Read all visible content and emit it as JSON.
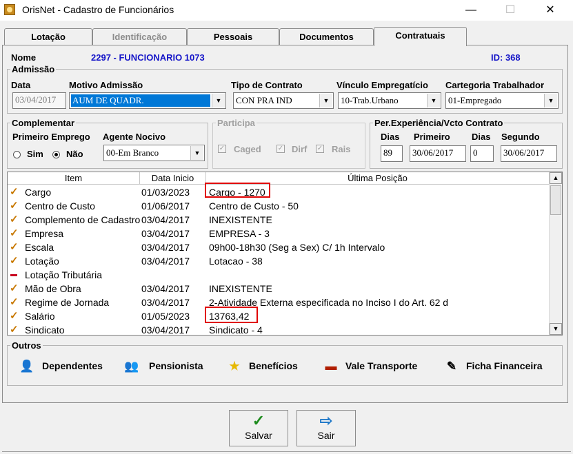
{
  "window": {
    "title": "OrisNet - Cadastro de Funcionários",
    "minimize": "—",
    "maximize": "☐",
    "close": "✕"
  },
  "tabs": [
    "Lotação",
    "Identificação",
    "Pessoais",
    "Documentos",
    "Contratuais"
  ],
  "header": {
    "nome_label": "Nome",
    "nome_value": "2297 - FUNCIONARIO 1073",
    "id_label": "ID: 368"
  },
  "admissao": {
    "legend": "Admissão",
    "data_label": "Data",
    "data_value": "03/04/2017",
    "motivo_label": "Motivo Admissão",
    "motivo_value": "AUM DE QUADR.",
    "tipo_label": "Tipo de Contrato",
    "tipo_value": "CON PRA IND",
    "vinculo_label": "Vínculo Empregatício",
    "vinculo_value": "10-Trab.Urbano",
    "categoria_label": "Cartegoria Trabalhador",
    "categoria_value": "01-Empregado"
  },
  "complementar": {
    "legend": "Complementar",
    "primeiro_emprego_label": "Primeiro Emprego",
    "sim_label": "Sim",
    "nao_label": "Não",
    "agente_label": "Agente Nocivo",
    "agente_value": "00-Em Branco"
  },
  "participa": {
    "legend": "Participa",
    "caged": "Caged",
    "dirf": "Dirf",
    "rais": "Rais"
  },
  "experiencia": {
    "legend": "Per.Experiência/Vcto Contrato",
    "dias_label": "Dias",
    "primeiro_label": "Primeiro",
    "dias2_label": "Dias",
    "segundo_label": "Segundo",
    "dias_value": "89",
    "primeiro_value": "30/06/2017",
    "dias2_value": "0",
    "segundo_value": "30/06/2017"
  },
  "grid": {
    "headers": [
      "Item",
      "Data Inicio",
      "Última Posição"
    ],
    "rows": [
      {
        "item": "Cargo",
        "data": "01/03/2023",
        "pos": "Cargo - 1270",
        "icon": "check"
      },
      {
        "item": "Centro de Custo",
        "data": "01/06/2017",
        "pos": "Centro de Custo - 50",
        "icon": "check"
      },
      {
        "item": "Complemento de Cadastro",
        "data": "03/04/2017",
        "pos": "INEXISTENTE",
        "icon": "check"
      },
      {
        "item": "Empresa",
        "data": "03/04/2017",
        "pos": "EMPRESA - 3",
        "icon": "check"
      },
      {
        "item": "Escala",
        "data": "03/04/2017",
        "pos": "09h00-18h30 (Seg a Sex) C/ 1h Intervalo",
        "icon": "check"
      },
      {
        "item": "Lotação",
        "data": "03/04/2017",
        "pos": "Lotacao - 38",
        "icon": "check"
      },
      {
        "item": "Lotação Tributária",
        "data": "",
        "pos": "",
        "icon": "dash"
      },
      {
        "item": "Mão de Obra",
        "data": "03/04/2017",
        "pos": "INEXISTENTE",
        "icon": "check"
      },
      {
        "item": "Regime de Jornada",
        "data": "03/04/2017",
        "pos": "2-Atividade Externa especificada no Inciso I do Art. 62 d",
        "icon": "check"
      },
      {
        "item": "Salário",
        "data": "01/05/2023",
        "pos": "13763,42",
        "icon": "check"
      },
      {
        "item": "Sindicato",
        "data": "03/04/2017",
        "pos": "Sindicato - 4",
        "icon": "check"
      }
    ]
  },
  "outros": {
    "legend": "Outros",
    "dependentes": "Dependentes",
    "pensionista": "Pensionista",
    "beneficios": "Benefícios",
    "vale_transporte": "Vale Transporte",
    "ficha_financeira": "Ficha Financeira"
  },
  "actions": {
    "salvar": "Salvar",
    "sair": "Sair"
  },
  "colors": {
    "blue_text": "#1515c8",
    "highlight": "#e00000",
    "selection": "#0078d7",
    "check": "#c87800"
  }
}
